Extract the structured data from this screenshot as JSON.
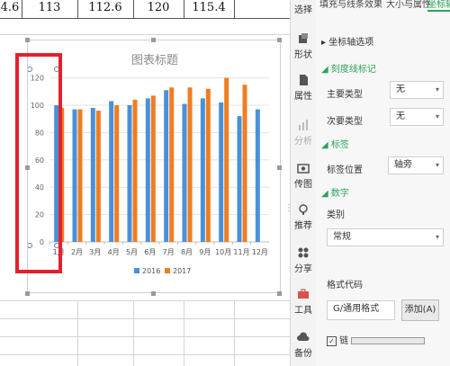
{
  "sheet": {
    "top_cells": [
      "4.6",
      "113",
      "112.6",
      "120",
      "115.4"
    ]
  },
  "chart_data": {
    "type": "bar",
    "title": "图表标题",
    "categories": [
      "1月",
      "2月",
      "3月",
      "4月",
      "5月",
      "6月",
      "7月",
      "8月",
      "9月",
      "10月",
      "11月",
      "12月"
    ],
    "series": [
      {
        "name": "2016",
        "color": "#4a90d9",
        "values": [
          100,
          97,
          98,
          103,
          100,
          105,
          111,
          101,
          105,
          102,
          92,
          97
        ]
      },
      {
        "name": "2017",
        "color": "#ef7d22",
        "values": [
          98,
          97,
          96,
          100,
          104,
          107,
          113,
          113,
          112,
          120,
          115,
          null
        ]
      }
    ],
    "yticks": [
      0,
      20,
      40,
      60,
      80,
      100,
      120
    ],
    "ylim": [
      0,
      125
    ],
    "legend": "bottom",
    "grid": true
  },
  "rail": {
    "items": [
      {
        "label": "选择",
        "icon": "select-icon"
      },
      {
        "label": "形状",
        "icon": "shape-icon"
      },
      {
        "label": "属性",
        "icon": "properties-icon"
      },
      {
        "label": "分析",
        "icon": "analysis-icon"
      },
      {
        "label": "传图",
        "icon": "upload-image-icon"
      },
      {
        "label": "推荐",
        "icon": "recommend-icon"
      },
      {
        "label": "分享",
        "icon": "share-icon"
      },
      {
        "label": "工具",
        "icon": "toolbox-icon"
      },
      {
        "label": "备份",
        "icon": "backup-icon"
      }
    ]
  },
  "panel": {
    "tabs": [
      "填充与线条",
      "效果",
      "大小与属性",
      "坐标轴"
    ],
    "axis_options": "坐标轴选项",
    "tick_marks_section": "刻度线标记",
    "major_type_label": "主要类型",
    "major_type_value": "无",
    "minor_type_label": "次要类型",
    "minor_type_value": "无",
    "labels_section": "标签",
    "label_position_label": "标签位置",
    "label_position_value": "轴旁",
    "number_section": "数字",
    "category_label": "类别",
    "category_value": "常规",
    "format_code_label": "格式代码",
    "format_code_value": "G/通用格式",
    "add_button": "添加(A)",
    "linked_checkbox": "链"
  },
  "colors": {
    "accent": "#2aa35a",
    "highlight": "#e5202e"
  }
}
